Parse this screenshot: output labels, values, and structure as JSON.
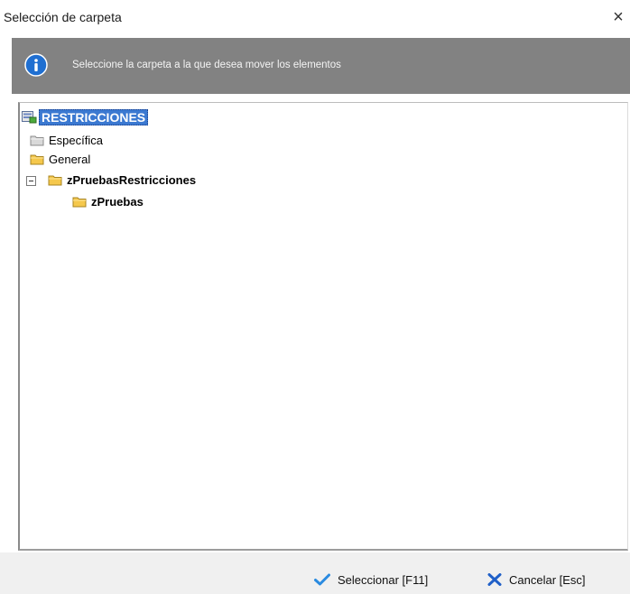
{
  "window": {
    "title": "Selección de carpeta",
    "close_glyph": "×"
  },
  "banner": {
    "icon": "info-icon",
    "message": "Seleccione la carpeta a la que desea mover los elementos"
  },
  "tree": {
    "root": {
      "label": "RESTRICCIONES",
      "icon": "database-icon",
      "selected": true
    },
    "items": [
      {
        "label": "Específica",
        "icon": "folder-icon",
        "bold": false
      },
      {
        "label": "General",
        "icon": "folder-icon",
        "bold": false
      },
      {
        "label": "zPruebasRestricciones",
        "icon": "folder-icon",
        "bold": true,
        "expanded": true
      },
      {
        "label": "zPruebas",
        "icon": "folder-icon",
        "bold": true
      }
    ]
  },
  "buttons": {
    "select": {
      "label": "Seleccionar [F11]",
      "icon": "checkmark-icon"
    },
    "cancel": {
      "label": "Cancelar [Esc]",
      "icon": "x-icon"
    }
  },
  "colors": {
    "banner_bg": "#828282",
    "selection_bg": "#3b79d1",
    "folder_yellow": "#f5c84c",
    "folder_gray": "#d9d9d9",
    "info_blue": "#1f6fd1",
    "check_blue": "#2a8be0",
    "cancel_blue": "#1f5fc8"
  }
}
